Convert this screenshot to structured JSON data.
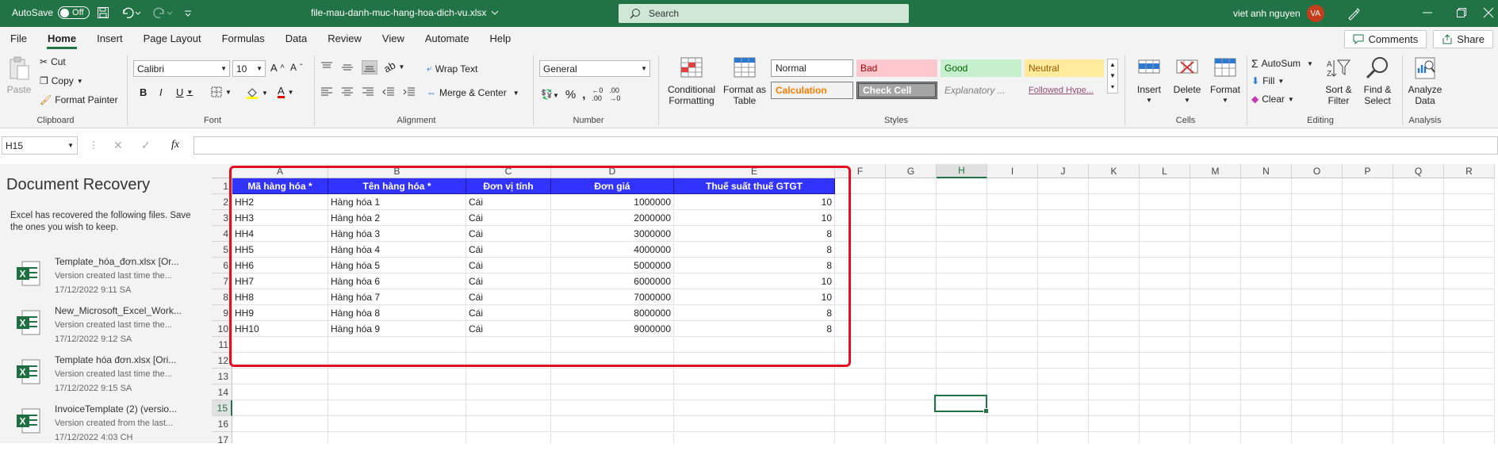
{
  "titlebar": {
    "autosave_label": "AutoSave",
    "autosave_state": "Off",
    "filename": "file-mau-danh-muc-hang-hoa-dich-vu.xlsx",
    "search_placeholder": "Search",
    "user_name": "viet anh nguyen",
    "user_initials": "VA"
  },
  "menu": {
    "items": [
      "File",
      "Home",
      "Insert",
      "Page Layout",
      "Formulas",
      "Data",
      "Review",
      "View",
      "Automate",
      "Help"
    ],
    "active": "Home",
    "comments_label": "Comments",
    "share_label": "Share"
  },
  "ribbon": {
    "clipboard": {
      "paste": "Paste",
      "cut": "Cut",
      "copy": "Copy",
      "format_painter": "Format Painter",
      "label": "Clipboard"
    },
    "font": {
      "name": "Calibri",
      "size": "10",
      "label": "Font"
    },
    "alignment": {
      "wrap": "Wrap Text",
      "merge": "Merge & Center",
      "label": "Alignment"
    },
    "number": {
      "format": "General",
      "label": "Number"
    },
    "styles": {
      "conditional": "Conditional Formatting",
      "format_table": "Format as Table",
      "cells": [
        "Normal",
        "Bad",
        "Good",
        "Neutral",
        "Calculation",
        "Check Cell",
        "Explanatory ...",
        "Followed Hype..."
      ],
      "label": "Styles"
    },
    "cells_group": {
      "insert": "Insert",
      "delete": "Delete",
      "format": "Format",
      "label": "Cells"
    },
    "editing": {
      "autosum": "AutoSum",
      "fill": "Fill",
      "clear": "Clear",
      "sort": "Sort & Filter",
      "find": "Find & Select",
      "label": "Editing"
    },
    "analysis": {
      "analyze": "Analyze Data",
      "label": "Analysis"
    }
  },
  "formula_bar": {
    "name_box": "H15",
    "fx": "fx",
    "value": ""
  },
  "recovery": {
    "title": "Document Recovery",
    "description": "Excel has recovered the following files.  Save the ones you wish to keep.",
    "files": [
      {
        "name": "Template_hóa_đơn.xlsx  [Or...",
        "desc": "Version created last time the...",
        "time": "17/12/2022 9:11 SA"
      },
      {
        "name": "New_Microsoft_Excel_Work...",
        "desc": "Version created last time the...",
        "time": "17/12/2022 9:12 SA"
      },
      {
        "name": "Template hóa đơn.xlsx  [Ori...",
        "desc": "Version created last time the...",
        "time": "17/12/2022 9:15 SA"
      },
      {
        "name": "InvoiceTemplate (2) (versio...",
        "desc": "Version created from the last...",
        "time": "17/12/2022 4:03 CH"
      }
    ]
  },
  "sheet": {
    "columns": [
      "A",
      "B",
      "C",
      "D",
      "E",
      "F",
      "G",
      "H",
      "I",
      "J",
      "K",
      "L",
      "M",
      "N",
      "O",
      "P",
      "Q",
      "R"
    ],
    "rows": [
      "1",
      "2",
      "3",
      "4",
      "5",
      "6",
      "7",
      "8",
      "9",
      "10",
      "11",
      "12",
      "13",
      "14",
      "15",
      "16",
      "17"
    ],
    "selected_col": "H",
    "selected_row": "15",
    "headers": [
      "Mã hàng hóa *",
      "Tên hàng hóa *",
      "Đơn vị tính",
      "Đơn giá",
      "Thuế suất thuế GTGT"
    ],
    "data": [
      [
        "HH2",
        "Hàng hóa 1",
        "Cái",
        "1000000",
        "10"
      ],
      [
        "HH3",
        "Hàng hóa 2",
        "Cái",
        "2000000",
        "10"
      ],
      [
        "HH4",
        "Hàng hóa 3",
        "Cái",
        "3000000",
        "8"
      ],
      [
        "HH5",
        "Hàng hóa 4",
        "Cái",
        "4000000",
        "8"
      ],
      [
        "HH6",
        "Hàng hóa 5",
        "Cái",
        "5000000",
        "8"
      ],
      [
        "HH7",
        "Hàng hóa 6",
        "Cái",
        "6000000",
        "10"
      ],
      [
        "HH8",
        "Hàng hóa 7",
        "Cái",
        "7000000",
        "10"
      ],
      [
        "HH9",
        "Hàng hóa 8",
        "Cái",
        "8000000",
        "8"
      ],
      [
        "HH10",
        "Hàng hóa 9",
        "Cái",
        "9000000",
        "8"
      ]
    ]
  }
}
